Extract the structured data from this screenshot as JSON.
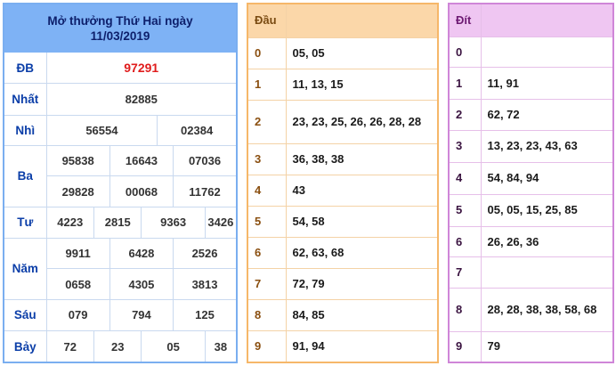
{
  "results": {
    "title_line1": "Mở thưởng Thứ Hai ngày",
    "title_line2": "11/03/2019",
    "rows": {
      "db": {
        "label": "ĐB",
        "values": [
          "97291"
        ]
      },
      "nhat": {
        "label": "Nhất",
        "values": [
          "82885"
        ]
      },
      "nhi": {
        "label": "Nhì",
        "values": [
          "56554",
          "02384"
        ]
      },
      "ba": {
        "label": "Ba",
        "values": [
          "95838",
          "16643",
          "07036",
          "29828",
          "00068",
          "11762"
        ]
      },
      "tu": {
        "label": "Tư",
        "values": [
          "4223",
          "2815",
          "9363",
          "3426"
        ]
      },
      "nam": {
        "label": "Năm",
        "values": [
          "9911",
          "6428",
          "2526",
          "0658",
          "4305",
          "3813"
        ]
      },
      "sau": {
        "label": "Sáu",
        "values": [
          "079",
          "794",
          "125"
        ]
      },
      "bay": {
        "label": "Bảy",
        "values": [
          "72",
          "23",
          "05",
          "38"
        ]
      }
    },
    "colors": {
      "special": "#e01c1c",
      "label": "#0b3ea8",
      "header_bg": "#7eb2f5"
    }
  },
  "dau": {
    "header": "Đầu",
    "rows": [
      {
        "digit": "0",
        "values": "05, 05"
      },
      {
        "digit": "1",
        "values": "11, 13, 15"
      },
      {
        "digit": "2",
        "values": "23, 23, 25, 26, 26, 28, 28"
      },
      {
        "digit": "3",
        "values": "36, 38, 38"
      },
      {
        "digit": "4",
        "values": "43"
      },
      {
        "digit": "5",
        "values": "54, 58"
      },
      {
        "digit": "6",
        "values": "62, 63, 68"
      },
      {
        "digit": "7",
        "values": "72, 79"
      },
      {
        "digit": "8",
        "values": "84, 85"
      },
      {
        "digit": "9",
        "values": "91, 94"
      }
    ]
  },
  "dit": {
    "header": "Đít",
    "rows": [
      {
        "digit": "0",
        "values": ""
      },
      {
        "digit": "1",
        "values": "11, 91"
      },
      {
        "digit": "2",
        "values": "62, 72"
      },
      {
        "digit": "3",
        "values": "13, 23, 23, 43, 63"
      },
      {
        "digit": "4",
        "values": "54, 84, 94"
      },
      {
        "digit": "5",
        "values": "05, 05, 15, 25, 85"
      },
      {
        "digit": "6",
        "values": "26, 26, 36"
      },
      {
        "digit": "7",
        "values": ""
      },
      {
        "digit": "8",
        "values": "28, 28, 38, 38, 58, 68"
      },
      {
        "digit": "9",
        "values": "79"
      }
    ]
  }
}
